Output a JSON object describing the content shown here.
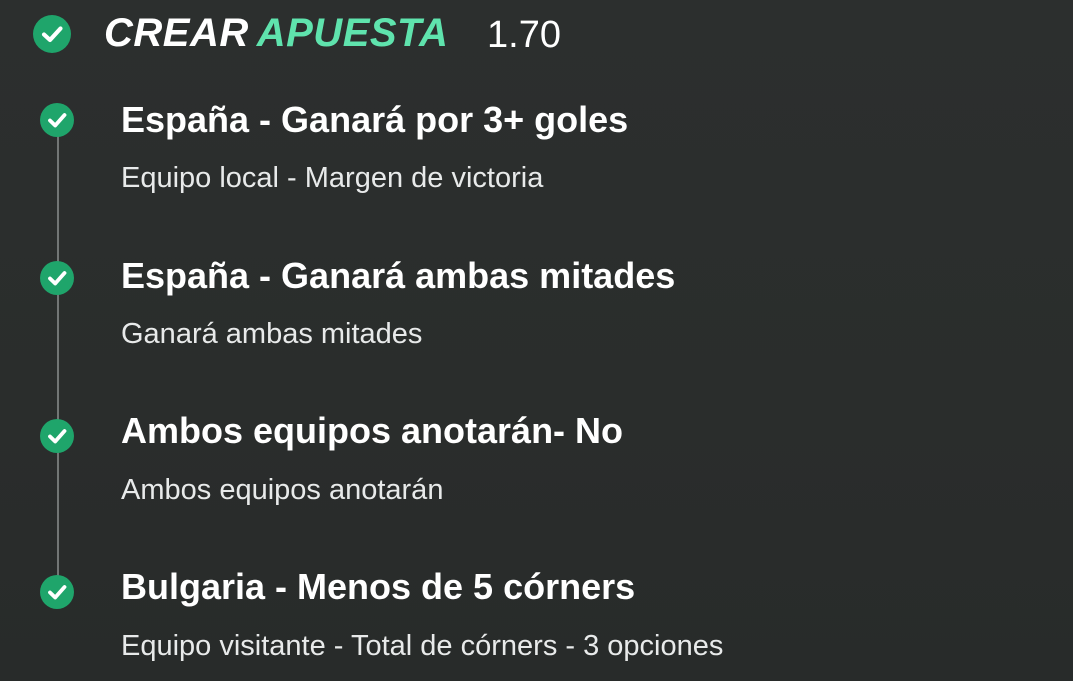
{
  "header": {
    "title_word1": "CREAR",
    "title_word2": "APUESTA",
    "odds": "1.70",
    "check_icon": "check-circle-icon"
  },
  "legs": [
    {
      "title": "España - Ganará por 3+ goles",
      "subtitle": "Equipo local - Margen de victoria",
      "icon": "check-circle-icon"
    },
    {
      "title": "España - Ganará ambas mitades",
      "subtitle": "Ganará ambas mitades",
      "icon": "check-circle-icon"
    },
    {
      "title": "Ambos equipos anotarán- No",
      "subtitle": "Ambos equipos anotarán",
      "icon": "check-circle-icon"
    },
    {
      "title": "Bulgaria - Menos de 5 córners",
      "subtitle": "Equipo visitante - Total de córners - 3 opciones",
      "icon": "check-circle-icon"
    }
  ],
  "colors": {
    "background": "#2b2e2d",
    "accent_green": "#5fe3ad",
    "check_green": "#1fa56b",
    "timeline": "#727675"
  }
}
